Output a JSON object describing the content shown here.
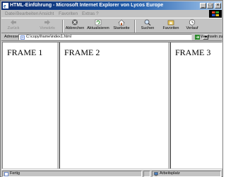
{
  "window": {
    "title": "HTML-Einführung - Microsoft Internet Explorer von Lycos Europe"
  },
  "menu": {
    "items": [
      "Datei",
      "Bearbeiten",
      "Ansicht",
      "Favoriten",
      "Extras",
      "?"
    ]
  },
  "toolbar": {
    "buttons": [
      {
        "label": "Zurück",
        "icon": "back-arrow-icon",
        "enabled": false
      },
      {
        "label": "Vorwärts",
        "icon": "forward-arrow-icon",
        "enabled": false
      },
      {
        "label": "Abbrechen",
        "icon": "stop-icon",
        "enabled": true
      },
      {
        "label": "Aktualisieren",
        "icon": "refresh-icon",
        "enabled": true
      },
      {
        "label": "Startseite",
        "icon": "home-icon",
        "enabled": true
      },
      {
        "label": "Suchen",
        "icon": "search-icon",
        "enabled": true
      },
      {
        "label": "Favoriten",
        "icon": "favorites-icon",
        "enabled": true
      },
      {
        "label": "Verlauf",
        "icon": "history-icon",
        "enabled": true
      }
    ]
  },
  "address": {
    "label": "Adresse",
    "value": "C:\\copy\\frame\\index1.html",
    "go_label": "Wechseln zu"
  },
  "frames": [
    {
      "title": "FRAME 1"
    },
    {
      "title": "FRAME 2"
    },
    {
      "title": "FRAME 3"
    }
  ],
  "status": {
    "text": "Fertig",
    "zone": "Arbeitsplatz"
  },
  "colors": {
    "chrome": "#c3c3c3",
    "title_start": "#0a2a6e",
    "title_end": "#a6caf0"
  }
}
